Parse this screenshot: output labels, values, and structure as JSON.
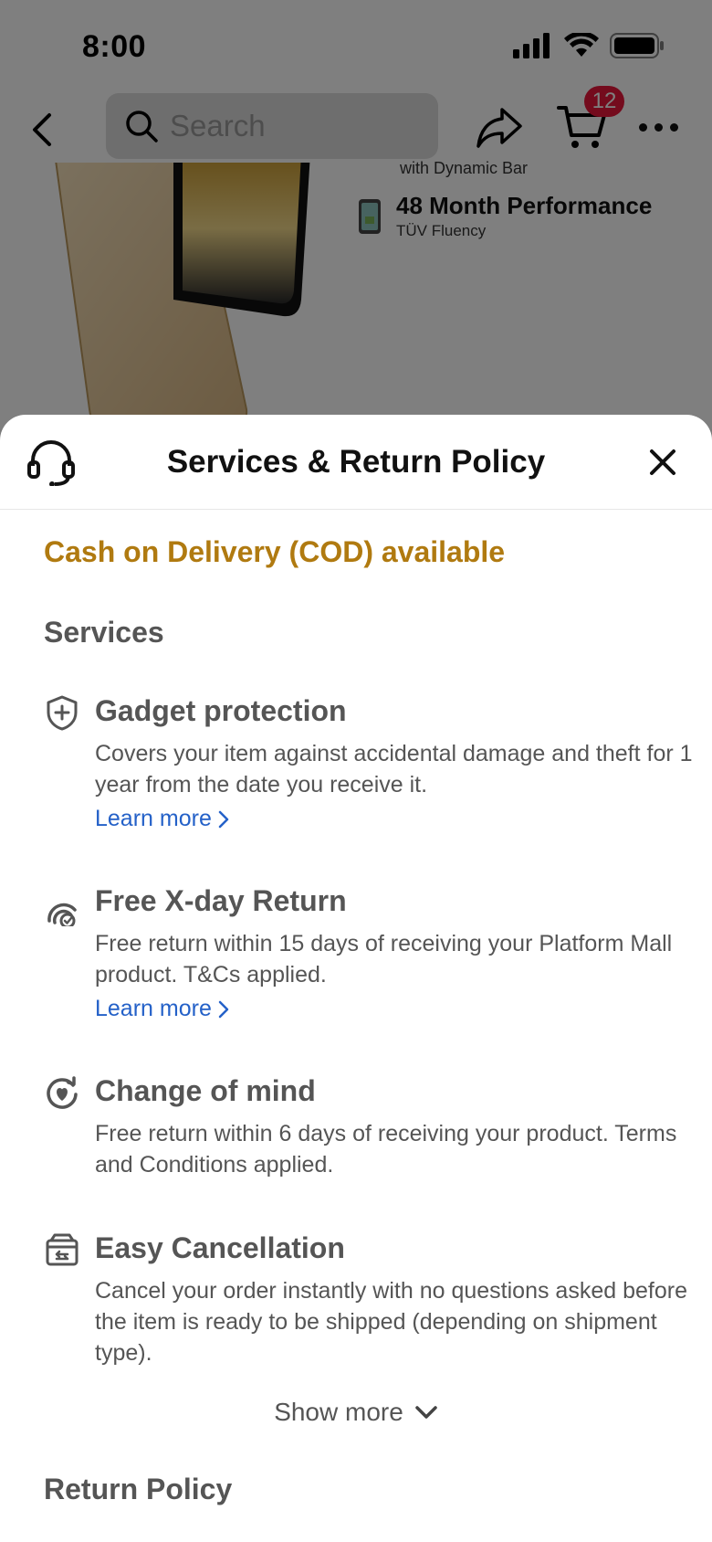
{
  "status_bar": {
    "time": "8:00"
  },
  "nav": {
    "search_placeholder": "Search",
    "cart_count": "12"
  },
  "background": {
    "feature_partial": "with Dynamic Bar",
    "feature_title": "48 Month Performance",
    "feature_subtitle": "TÜV Fluency"
  },
  "sheet": {
    "title": "Services & Return Policy",
    "cod_notice": "Cash on Delivery (COD) available",
    "services_heading": "Services",
    "services": [
      {
        "name": "Gadget protection",
        "description": "Covers your item against accidental damage and theft for 1 year from the date you receive it.",
        "link": "Learn more",
        "icon": "shield-plus-icon"
      },
      {
        "name": "Free X-day Return",
        "description": "Free return within 15 days of receiving your Platform Mall product. T&Cs applied.",
        "link": "Learn more",
        "icon": "return-badge-icon"
      },
      {
        "name": "Change of mind",
        "description": "Free return within 6 days of receiving your product. Terms and Conditions applied.",
        "icon": "heart-cycle-icon"
      },
      {
        "name": "Easy Cancellation",
        "description": "Cancel your order instantly with no questions asked before the item is ready to be shipped (depending on shipment type).",
        "icon": "box-return-icon"
      }
    ],
    "show_more": "Show more",
    "return_policy_heading": "Return Policy"
  },
  "colors": {
    "accent_gold": "#b07a10",
    "link_blue": "#2461c8",
    "badge_red": "#e8163b"
  }
}
